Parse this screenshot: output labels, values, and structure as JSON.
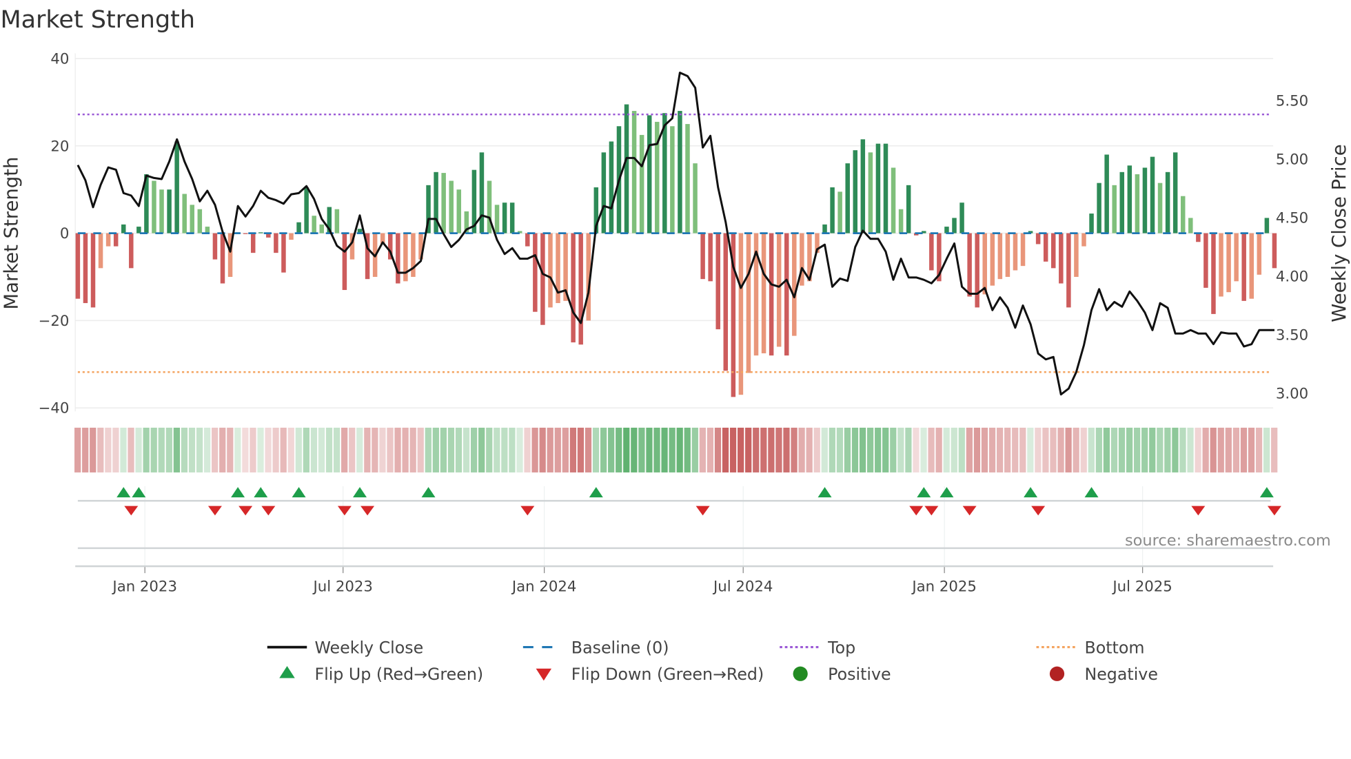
{
  "chart_data": {
    "type": "bar",
    "title": "Market Strength",
    "ylabel": "Market Strength",
    "y2label": "Weekly Close Price",
    "ylim": [
      -40,
      40
    ],
    "y2lim": [
      2.83,
      5.86
    ],
    "yticks": [
      "40",
      "20",
      "0",
      "−20",
      "−40"
    ],
    "ytick_values": [
      40,
      20,
      0,
      -20,
      -40
    ],
    "y2ticks": [
      "5.50",
      "5.00",
      "4.50",
      "4.00",
      "3.50",
      "3.00"
    ],
    "y2tick_values": [
      5.5,
      5.0,
      4.5,
      4.0,
      3.5,
      3.0
    ],
    "xticks": [
      {
        "label": "Jan 2023",
        "week": 8.8
      },
      {
        "label": "Jul 2023",
        "week": 34.8
      },
      {
        "label": "Jan 2024",
        "week": 61.2
      },
      {
        "label": "Jul 2024",
        "week": 87.3
      },
      {
        "label": "Jan 2025",
        "week": 113.7
      },
      {
        "label": "Jul 2025",
        "week": 139.7
      }
    ],
    "top_level": 27.2,
    "bottom_level": -31.8,
    "baseline": 0,
    "strength": [
      -15,
      -16,
      -17,
      -8,
      -3,
      -3,
      2,
      -8,
      1.5,
      13.5,
      12,
      10,
      10,
      21,
      9,
      6.5,
      5.5,
      1.5,
      -6,
      -11.5,
      -10,
      0.2,
      -0.2,
      -4.5,
      0.2,
      -1,
      -4.5,
      -9,
      -1.5,
      2.5,
      10.5,
      4,
      2,
      6,
      5.5,
      -13,
      -6,
      1,
      -10.5,
      -10,
      -2.5,
      -6,
      -11.5,
      -11,
      -10,
      -6,
      11,
      14,
      13.8,
      12,
      10,
      5,
      14.5,
      18.5,
      12,
      6.5,
      7,
      7,
      0.5,
      -3,
      -18,
      -21,
      -17,
      -16,
      -15.5,
      -25,
      -25.5,
      -20,
      10.5,
      18.5,
      21,
      24.5,
      29.5,
      28,
      22.5,
      27,
      25.5,
      27.5,
      24.5,
      28,
      25,
      16,
      -10.5,
      -11,
      -22,
      -31.5,
      -37.5,
      -37,
      -32,
      -28,
      -27.5,
      -28,
      -26,
      -28,
      -23.5,
      -12,
      -11,
      -4.5,
      2,
      10.5,
      9.5,
      16,
      19,
      21.5,
      18.5,
      20.5,
      20.5,
      15,
      5.5,
      11,
      -0.5,
      0.5,
      -8.5,
      -11,
      1.5,
      3.5,
      7,
      -14.5,
      -17,
      -14,
      -12,
      -10.5,
      -10,
      -8.5,
      -7.5,
      0.5,
      -2.5,
      -6.5,
      -8,
      -11.5,
      -17,
      -10,
      -3,
      4.5,
      11.5,
      18,
      11,
      14,
      15.5,
      13.5,
      15,
      17.5,
      11.5,
      14,
      18.5,
      8.5,
      3.5,
      -2,
      -12.5,
      -18.5,
      -14.5,
      -13.5,
      -11,
      -15.5,
      -15,
      -9.5,
      3.5,
      -8
    ],
    "weekly_close": [
      4.95,
      4.82,
      4.59,
      4.78,
      4.93,
      4.91,
      4.71,
      4.69,
      4.6,
      4.86,
      4.84,
      4.83,
      4.98,
      5.17,
      4.98,
      4.83,
      4.64,
      4.73,
      4.61,
      4.38,
      4.21,
      4.6,
      4.51,
      4.6,
      4.73,
      4.67,
      4.65,
      4.62,
      4.7,
      4.71,
      4.77,
      4.66,
      4.49,
      4.4,
      4.26,
      4.21,
      4.29,
      4.52,
      4.24,
      4.17,
      4.29,
      4.21,
      4.03,
      4.03,
      4.07,
      4.13,
      4.49,
      4.49,
      4.36,
      4.25,
      4.31,
      4.4,
      4.43,
      4.52,
      4.5,
      4.31,
      4.19,
      4.24,
      4.15,
      4.15,
      4.18,
      4.02,
      3.99,
      3.86,
      3.88,
      3.69,
      3.6,
      3.86,
      4.43,
      4.6,
      4.58,
      4.82,
      5.01,
      5.01,
      4.94,
      5.12,
      5.13,
      5.29,
      5.35,
      5.74,
      5.71,
      5.61,
      5.1,
      5.2,
      4.76,
      4.46,
      4.08,
      3.9,
      4.02,
      4.21,
      4.02,
      3.93,
      3.91,
      3.97,
      3.82,
      4.07,
      3.97,
      4.23,
      4.27,
      3.91,
      3.98,
      3.96,
      4.25,
      4.39,
      4.32,
      4.32,
      4.21,
      3.97,
      4.15,
      3.99,
      3.99,
      3.97,
      3.94,
      4.01,
      4.15,
      4.28,
      3.91,
      3.85,
      3.85,
      3.9,
      3.71,
      3.82,
      3.73,
      3.56,
      3.75,
      3.59,
      3.34,
      3.29,
      3.31,
      2.99,
      3.04,
      3.18,
      3.41,
      3.71,
      3.89,
      3.71,
      3.78,
      3.74,
      3.87,
      3.79,
      3.69,
      3.54,
      3.77,
      3.73,
      3.51,
      3.51,
      3.54,
      3.51,
      3.51,
      3.42,
      3.52,
      3.51,
      3.51,
      3.4,
      3.42,
      3.54,
      3.54,
      3.54
    ],
    "legend": {
      "placement": "bottom",
      "items": [
        "Weekly Close",
        "Baseline (0)",
        "Top",
        "Bottom",
        "Flip Up (Red→Green)",
        "Flip Down (Green→Red)",
        "Positive",
        "Negative"
      ]
    },
    "source": "source: sharemaestro.com"
  },
  "colors": {
    "green_dark": "#2e8b57",
    "green_light": "#7fbf7b",
    "red_dark": "#cd5c5c",
    "red_light": "#e9967a",
    "line": "#111111",
    "baseline": "#1f77b4",
    "top": "#9b59d6",
    "bottom": "#f4a460",
    "flip_up": "#1e9e4a",
    "flip_down": "#d62728",
    "positive": "#228b22",
    "negative": "#b22222"
  }
}
